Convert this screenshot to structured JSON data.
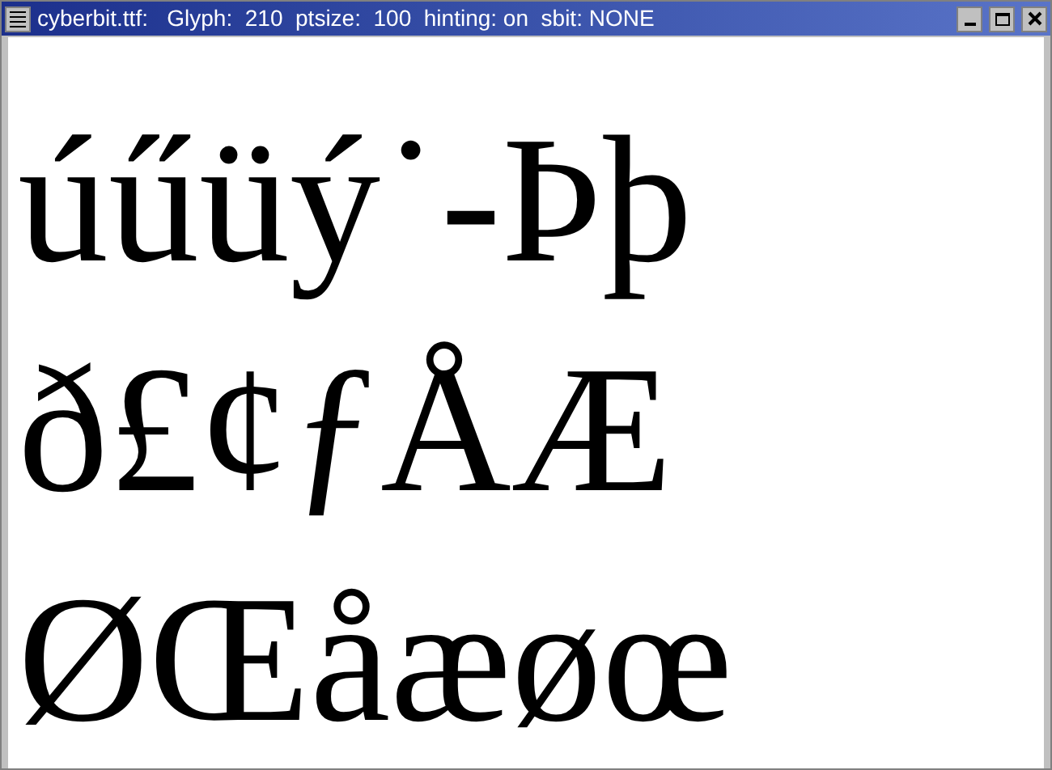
{
  "window": {
    "title": "cyberbit.ttf:   Glyph:  210  ptsize:  100  hinting: on  sbit: NONE"
  },
  "glyph_rows": [
    "úűüý˙-Þþ",
    "ð£¢ƒÅÆ",
    "ØŒåæøœ"
  ]
}
